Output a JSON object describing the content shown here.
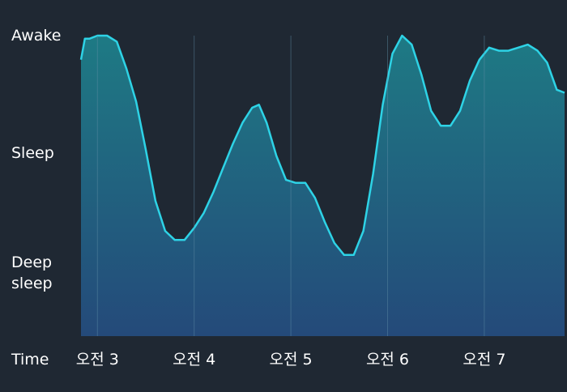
{
  "colors": {
    "background": "#1f2833",
    "line": "#2ed3e6",
    "fill_top": "#1e7a84",
    "fill_bottom": "#244a7a",
    "gridline": "#5f8fa6",
    "text": "#ffffff"
  },
  "chart_data": {
    "type": "area",
    "title": "",
    "xlabel": "Time",
    "ylabel": "",
    "y_levels": [
      "Awake",
      "Sleep",
      "Deep sleep"
    ],
    "y_ticks": [
      {
        "value": 1.0,
        "label": "Awake"
      },
      {
        "value": 0.61,
        "label": "Sleep"
      },
      {
        "value": 0.21,
        "label": "Deep\nsleep"
      }
    ],
    "ylim": [
      0,
      1
    ],
    "x_ticks": [
      {
        "value": 3.0,
        "label": "오전 3"
      },
      {
        "value": 4.0,
        "label": "오전 4"
      },
      {
        "value": 5.0,
        "label": "오전 5"
      },
      {
        "value": 6.0,
        "label": "오전 6"
      },
      {
        "value": 7.0,
        "label": "오전 7"
      }
    ],
    "xlim": [
      2.83,
      7.83
    ],
    "grid": true,
    "series": [
      {
        "x": [
          2.83,
          2.87,
          2.92,
          3.0,
          3.1,
          3.2,
          3.3,
          3.4,
          3.5,
          3.6,
          3.7,
          3.8,
          3.9,
          4.0,
          4.1,
          4.2,
          4.3,
          4.4,
          4.5,
          4.6,
          4.67,
          4.75,
          4.85,
          4.95,
          5.05,
          5.15,
          5.25,
          5.35,
          5.45,
          5.55,
          5.65,
          5.75,
          5.85,
          5.95,
          6.05,
          6.15,
          6.25,
          6.35,
          6.45,
          6.55,
          6.65,
          6.75,
          6.85,
          6.95,
          7.05,
          7.15,
          7.25,
          7.35,
          7.45,
          7.55,
          7.65,
          7.75,
          7.83
        ],
        "y": [
          0.92,
          0.99,
          0.99,
          1.0,
          1.0,
          0.98,
          0.89,
          0.78,
          0.62,
          0.45,
          0.35,
          0.32,
          0.32,
          0.36,
          0.41,
          0.48,
          0.56,
          0.64,
          0.71,
          0.76,
          0.77,
          0.71,
          0.6,
          0.52,
          0.51,
          0.51,
          0.46,
          0.38,
          0.31,
          0.27,
          0.27,
          0.35,
          0.54,
          0.77,
          0.94,
          1.0,
          0.97,
          0.87,
          0.75,
          0.7,
          0.7,
          0.75,
          0.85,
          0.92,
          0.96,
          0.95,
          0.95,
          0.96,
          0.97,
          0.95,
          0.91,
          0.82,
          0.81
        ]
      }
    ]
  }
}
